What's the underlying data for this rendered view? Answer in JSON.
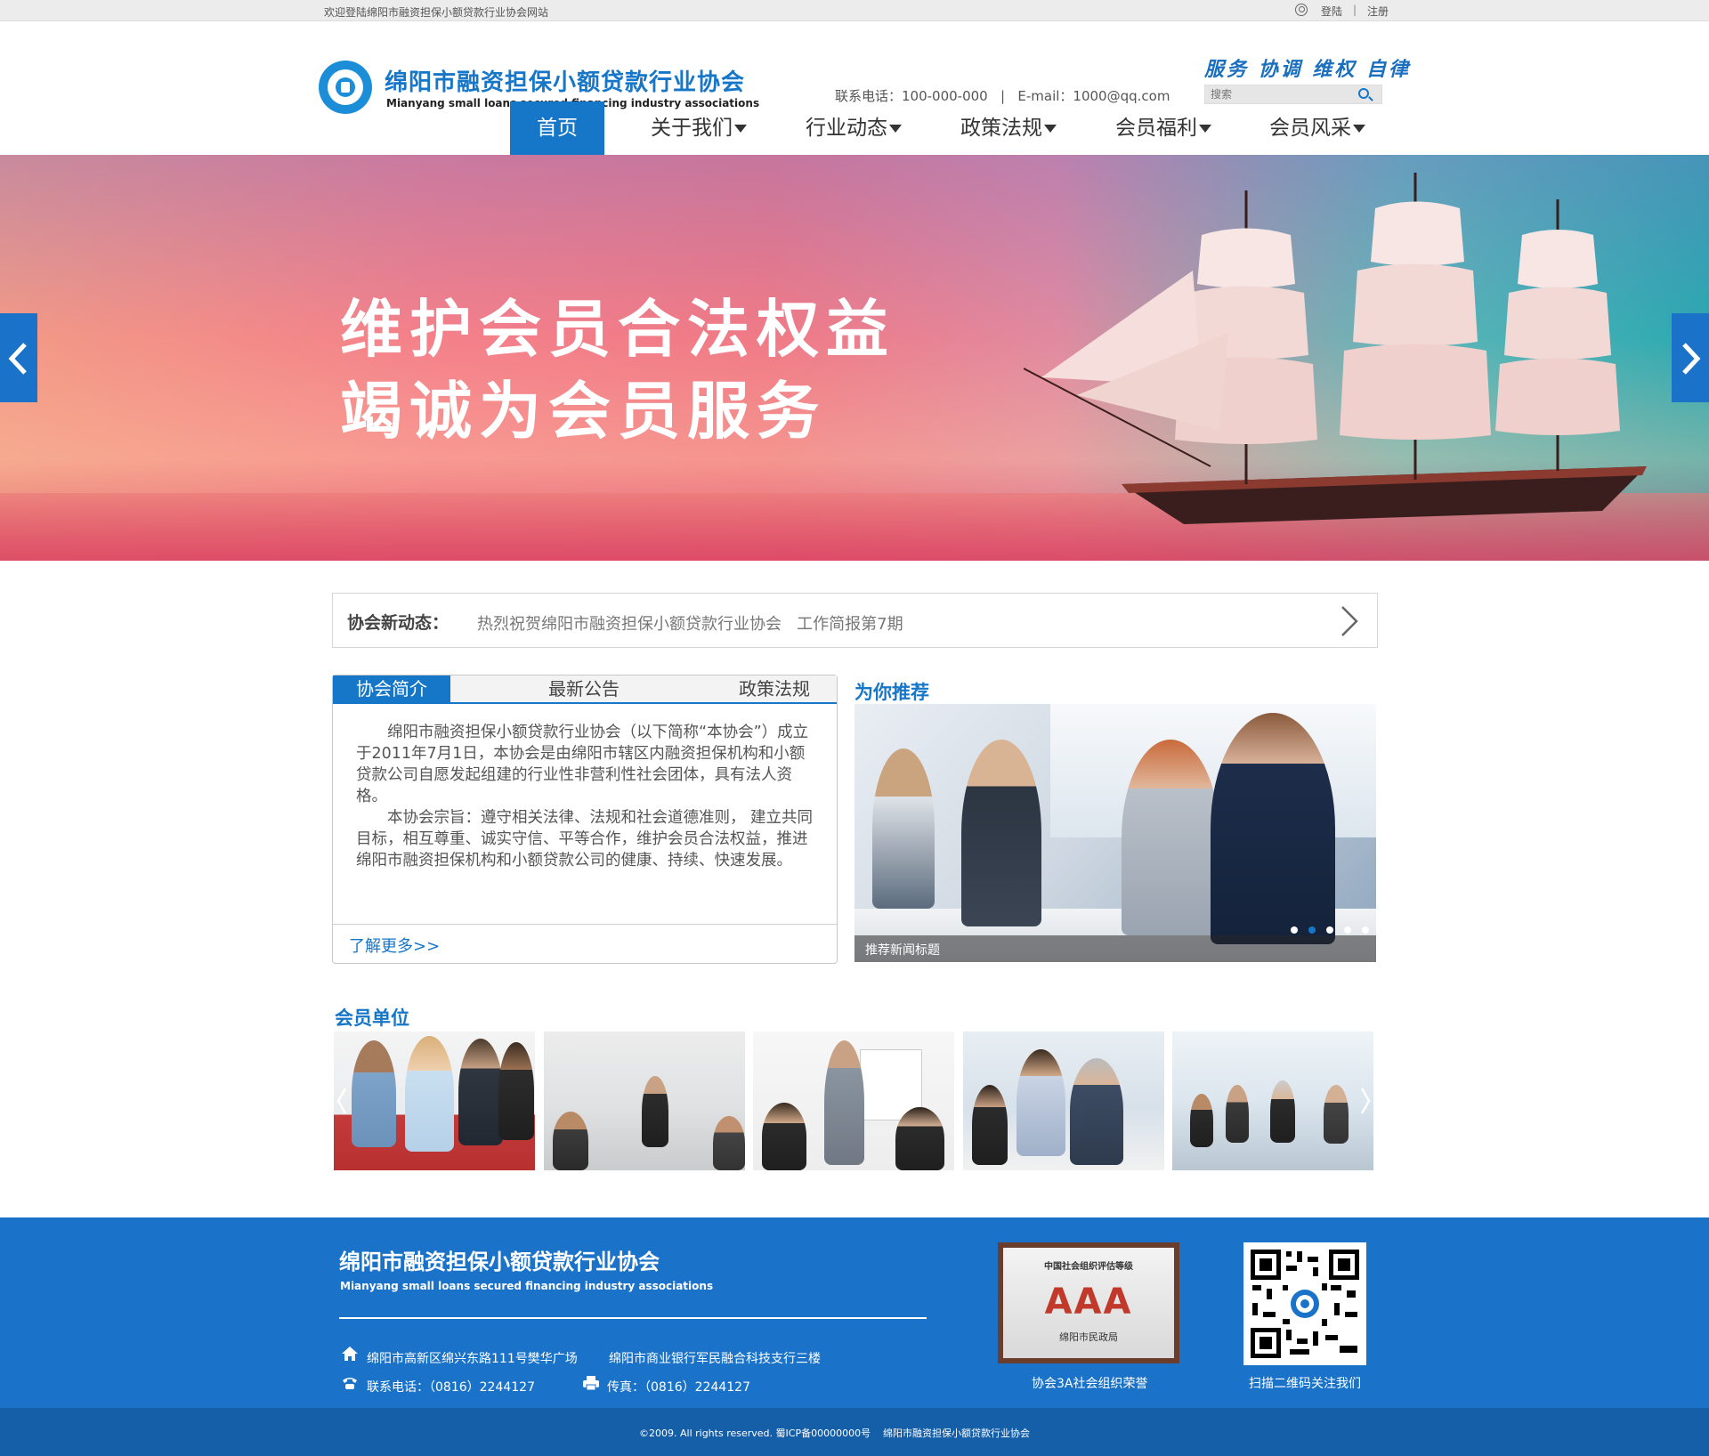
{
  "topbar": {
    "welcome": "欢迎登陆绵阳市融资担保小额贷款行业协会网站",
    "login": "登陆",
    "separator": "|",
    "register": "注册"
  },
  "header": {
    "logo_cn": "绵阳市融资担保小额贷款行业协会",
    "logo_en": "Mianyang small loans secured financing industry associations",
    "slogan": "服务 协调 维权 自律",
    "contact": "联系电话：100-000-000   |   E-mail：1000@qq.com",
    "search_placeholder": "搜索"
  },
  "nav": {
    "items": [
      {
        "label": "首页"
      },
      {
        "label": "关于我们"
      },
      {
        "label": "行业动态"
      },
      {
        "label": "政策法规"
      },
      {
        "label": "会员福利"
      },
      {
        "label": "会员风采"
      }
    ]
  },
  "banner": {
    "line1": "维护会员合法权益",
    "line2": "竭诚为会员服务"
  },
  "ticker": {
    "label": "协会新动态：",
    "text": "热烈祝贺绵阳市融资担保小额贷款行业协会   工作简报第7期"
  },
  "tabs": {
    "items": [
      {
        "label": "协会简介"
      },
      {
        "label": "最新公告"
      },
      {
        "label": "政策法规"
      }
    ],
    "intro_p1": "绵阳市融资担保小额贷款行业协会（以下简称“本协会”）成立于2011年7月1日，本协会是由绵阳市辖区内融资担保机构和小额贷款公司自愿发起组建的行业性非营利性社会团体，具有法人资格。",
    "intro_p2": "本协会宗旨：遵守相关法律、法规和社会道德准则， 建立共同目标，相互尊重、诚实守信、平等合作，维护会员合法权益，推进绵阳市融资担保机构和小额贷款公司的健康、持续、快速发展。",
    "more": "了解更多>>"
  },
  "recommend": {
    "title": "为你推荐",
    "caption": "推荐新闻标题",
    "active_dot": 2,
    "dot_count": 5
  },
  "members": {
    "title": "会员单位"
  },
  "footer": {
    "name_cn": "绵阳市融资担保小额贷款行业协会",
    "name_en": "Mianyang small loans secured financing industry associations",
    "address1": "绵阳市高新区绵兴东路111号樊华广场",
    "address2": "绵阳市商业银行军民融合科技支行三楼",
    "phone": "联系电话：（0816）2244127",
    "fax": "传真：（0816）2244127",
    "award_header": "中国社会组织评估等级",
    "award_grade": "AAA",
    "award_issuer": "绵阳市民政局",
    "award_caption": "协会3A社会组织荣誉",
    "qr_caption": "扫描二维码关注我们"
  },
  "bottom": {
    "copyright": "©2009. All rights reserved. 蜀ICP备00000000号",
    "name": "绵阳市融资担保小额贷款行业协会"
  },
  "colors": {
    "brand_blue": "#1676c8",
    "footer_blue": "#1a73c9",
    "bottom_blue": "#155ea8"
  }
}
